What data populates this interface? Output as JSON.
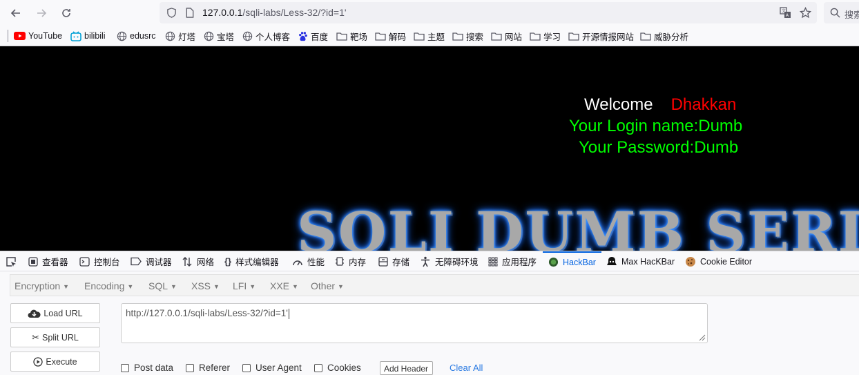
{
  "browser": {
    "url_host": "127.0.0.1",
    "url_rest": "/sqli-labs/Less-32/?id=1'",
    "search_placeholder": "搜索"
  },
  "bookmarks": [
    {
      "label": "YouTube",
      "icon": "youtube-icon"
    },
    {
      "label": "bilibili",
      "icon": "bilibili-icon"
    },
    {
      "label": "edusrc",
      "icon": "globe-icon"
    },
    {
      "label": "灯塔",
      "icon": "globe-icon"
    },
    {
      "label": "宝塔",
      "icon": "globe-icon"
    },
    {
      "label": "个人博客",
      "icon": "globe-icon"
    },
    {
      "label": "百度",
      "icon": "baidu-icon"
    },
    {
      "label": "靶场",
      "icon": "folder-icon"
    },
    {
      "label": "解码",
      "icon": "folder-icon"
    },
    {
      "label": "主题",
      "icon": "folder-icon"
    },
    {
      "label": "搜索",
      "icon": "folder-icon"
    },
    {
      "label": "网站",
      "icon": "folder-icon"
    },
    {
      "label": "学习",
      "icon": "folder-icon"
    },
    {
      "label": "开源情报网站",
      "icon": "folder-icon"
    },
    {
      "label": "威胁分析",
      "icon": "folder-icon"
    }
  ],
  "page": {
    "welcome": "Welcome",
    "name": "Dhakkan",
    "login": "Your Login name:Dumb",
    "password": "Your Password:Dumb",
    "banner": "SQLI DUMB SERIES",
    "colors": {
      "welcome": "#ffffff",
      "name": "#ff0000",
      "info": "#00ff00",
      "background": "#000000"
    }
  },
  "devtools": {
    "tabs": [
      {
        "label": "查看器",
        "icon": "inspector-icon"
      },
      {
        "label": "控制台",
        "icon": "console-icon"
      },
      {
        "label": "调试器",
        "icon": "debugger-icon"
      },
      {
        "label": "网络",
        "icon": "network-icon"
      },
      {
        "label": "样式编辑器",
        "icon": "style-editor-icon"
      },
      {
        "label": "性能",
        "icon": "performance-icon"
      },
      {
        "label": "内存",
        "icon": "memory-icon"
      },
      {
        "label": "存储",
        "icon": "storage-icon"
      },
      {
        "label": "无障碍环境",
        "icon": "accessibility-icon"
      },
      {
        "label": "应用程序",
        "icon": "application-icon"
      },
      {
        "label": "HackBar",
        "icon": "hackbar-icon"
      },
      {
        "label": "Max HacKBar",
        "icon": "max-hackbar-icon"
      },
      {
        "label": "Cookie Editor",
        "icon": "cookie-icon"
      }
    ],
    "active_tab": "HackBar",
    "accent": "#0061e0"
  },
  "hackbar": {
    "menu": [
      "Encryption",
      "Encoding",
      "SQL",
      "XSS",
      "LFI",
      "XXE",
      "Other"
    ],
    "buttons": {
      "load": "Load URL",
      "split": "Split URL",
      "execute": "Execute"
    },
    "url_value": "http://127.0.0.1/sqli-labs/Less-32/?id=1'",
    "options": [
      "Post data",
      "Referer",
      "User Agent",
      "Cookies"
    ],
    "add_header": "Add Header",
    "clear_all": "Clear All"
  }
}
